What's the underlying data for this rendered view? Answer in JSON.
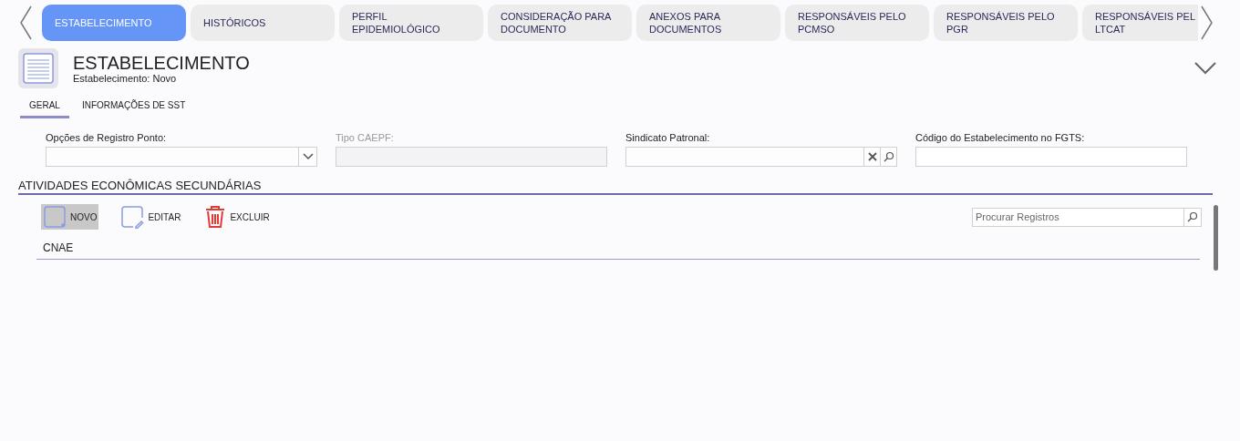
{
  "tabs": [
    {
      "label": "ESTABELECIMENTO",
      "selected": true
    },
    {
      "label": "HISTÓRICOS",
      "selected": false
    },
    {
      "label": "PERFIL EPIDEMIOLÓGICO",
      "selected": false
    },
    {
      "label": "CONSIDERAÇÃO PARA DOCUMENTO",
      "selected": false
    },
    {
      "label": "ANEXOS PARA DOCUMENTOS",
      "selected": false
    },
    {
      "label": "RESPONSÁVEIS PELO PCMSO",
      "selected": false
    },
    {
      "label": "RESPONSÁVEIS PELO PGR",
      "selected": false
    },
    {
      "label": "RESPONSÁVEIS PEL LTCAT",
      "selected": false
    }
  ],
  "header": {
    "title": "ESTABELECIMENTO",
    "subtitle": "Estabelecimento: Novo"
  },
  "subtabs": [
    {
      "label": "GERAL",
      "selected": true
    },
    {
      "label": "INFORMAÇÕES DE SST",
      "selected": false
    }
  ],
  "fields": [
    {
      "kind": "select",
      "label": "Opções de Registro Ponto:",
      "disabled": false
    },
    {
      "kind": "text",
      "label": "Tipo CAEPF:",
      "disabled": true
    },
    {
      "kind": "lookup",
      "label": "Sindicato Patronal:",
      "disabled": false
    },
    {
      "kind": "text",
      "label": "Código do Estabelecimento no FGTS:",
      "disabled": false
    }
  ],
  "section": {
    "title": "ATIVIDADES ECONÔMICAS SECUNDÁRIAS",
    "toolbar": [
      {
        "kind": "new",
        "label": "NOVO",
        "hovered": true
      },
      {
        "kind": "edit",
        "label": "EDITAR",
        "hovered": false
      },
      {
        "kind": "delete",
        "label": "EXCLUIR",
        "hovered": false
      }
    ],
    "search": {
      "placeholder": "Procurar Registros"
    },
    "table": {
      "columns": [
        "CNAE"
      ]
    }
  }
}
